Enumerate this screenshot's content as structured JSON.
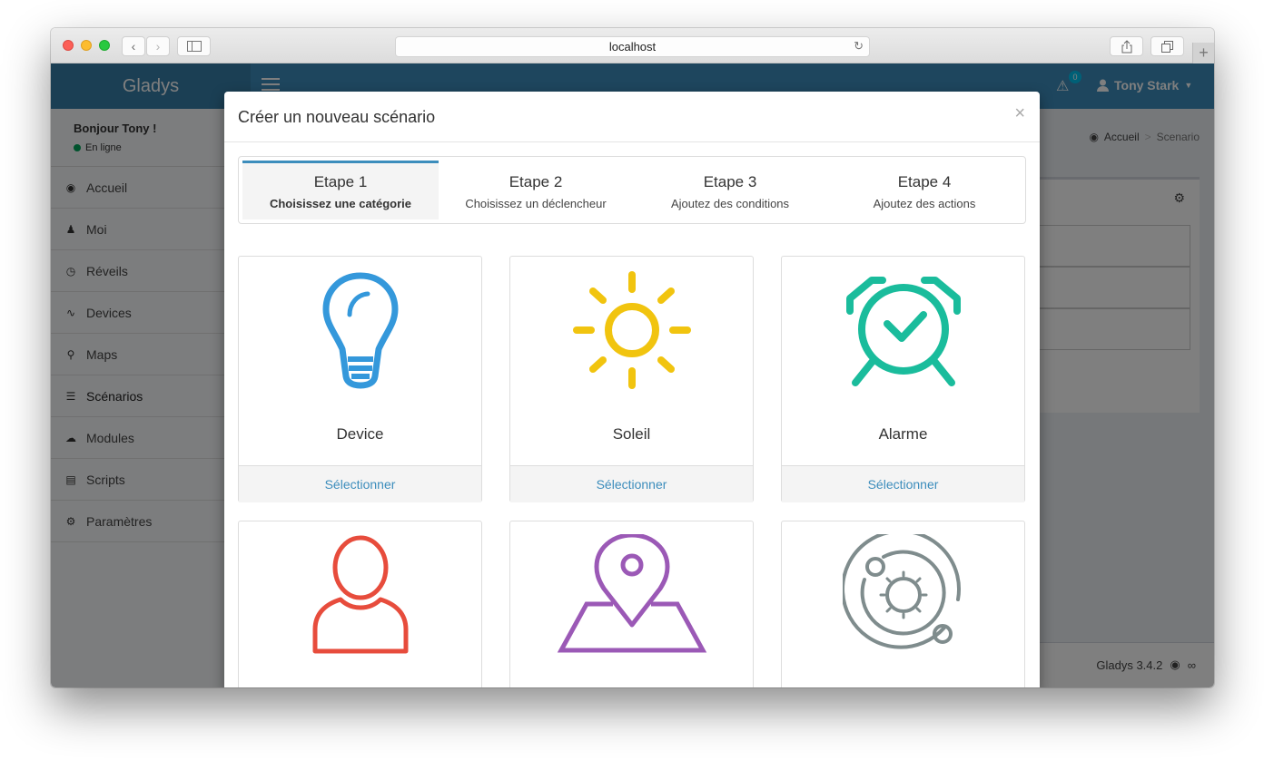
{
  "browser": {
    "url": "localhost"
  },
  "navbar": {
    "logo": "Gladys",
    "alert_count": "0",
    "user_name": "Tony Stark"
  },
  "sidebar": {
    "greeting": "Bonjour Tony !",
    "status": "En ligne",
    "items": [
      {
        "label": "Accueil",
        "icon": "dashboard-icon"
      },
      {
        "label": "Moi",
        "icon": "user-icon"
      },
      {
        "label": "Réveils",
        "icon": "clock-icon"
      },
      {
        "label": "Devices",
        "icon": "rss-icon"
      },
      {
        "label": "Maps",
        "icon": "map-marker-icon"
      },
      {
        "label": "Scénarios",
        "icon": "tasks-icon"
      },
      {
        "label": "Modules",
        "icon": "cloud-download-icon"
      },
      {
        "label": "Scripts",
        "icon": "file-text-icon"
      },
      {
        "label": "Paramètres",
        "icon": "gear-icon"
      }
    ]
  },
  "breadcrumb": {
    "home": "Accueil",
    "separator": ">",
    "current": "Scenario"
  },
  "footer": {
    "version": "Gladys 3.4.2"
  },
  "modal": {
    "title": "Créer un nouveau scénario",
    "close": "×",
    "steps": [
      {
        "title": "Etape 1",
        "subtitle": "Choisissez une catégorie",
        "active": true
      },
      {
        "title": "Etape 2",
        "subtitle": "Choisissez un déclencheur",
        "active": false
      },
      {
        "title": "Etape 3",
        "subtitle": "Ajoutez des conditions",
        "active": false
      },
      {
        "title": "Etape 4",
        "subtitle": "Ajoutez des actions",
        "active": false
      }
    ],
    "categories": [
      {
        "label": "Device",
        "action": "Sélectionner",
        "icon": "lightbulb-icon",
        "color": "#3498db"
      },
      {
        "label": "Soleil",
        "action": "Sélectionner",
        "icon": "sun-icon",
        "color": "#f1c40f"
      },
      {
        "label": "Alarme",
        "action": "Sélectionner",
        "icon": "alarm-clock-icon",
        "color": "#1abc9c"
      },
      {
        "label": "",
        "action": "",
        "icon": "person-icon",
        "color": "#e74c3c"
      },
      {
        "label": "",
        "action": "",
        "icon": "map-pin-icon",
        "color": "#9b59b6"
      },
      {
        "label": "",
        "action": "",
        "icon": "orbit-icon",
        "color": "#7f8c8d"
      }
    ]
  },
  "colors": {
    "primary": "#3c8dbc",
    "navbar_logo": "#367fa9",
    "online": "#00a65a"
  }
}
